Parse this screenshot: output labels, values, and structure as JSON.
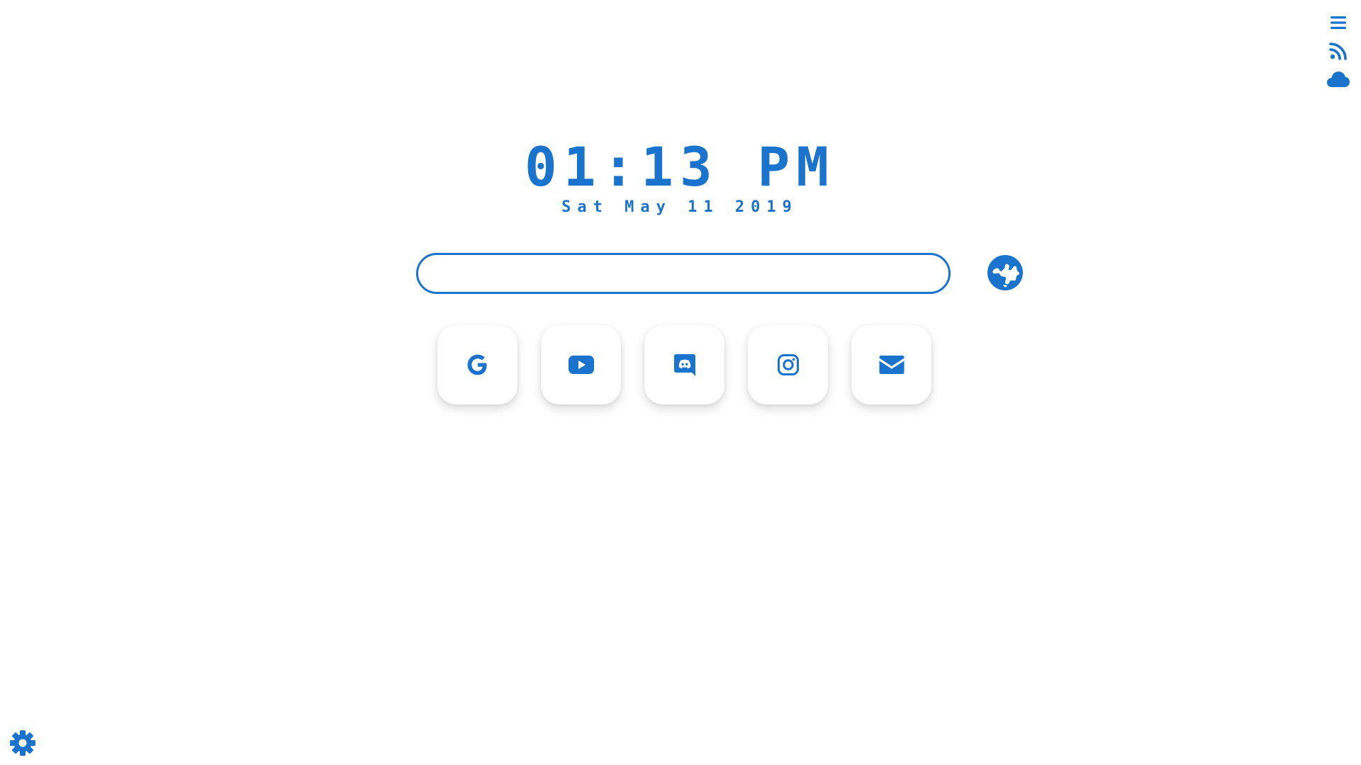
{
  "theme": {
    "accent": "#1a73cc",
    "background": "#ffffff"
  },
  "side_menu": {
    "items": [
      {
        "icon": "menu-icon"
      },
      {
        "icon": "rss-feed-icon"
      },
      {
        "icon": "cloud-icon"
      }
    ]
  },
  "clock": {
    "time": "01:13 PM",
    "date": "Sat May 11 2019"
  },
  "search": {
    "value": "",
    "placeholder": "",
    "engine_icon": "globe-icon"
  },
  "quick_links": [
    {
      "icon": "google-icon"
    },
    {
      "icon": "youtube-icon"
    },
    {
      "icon": "discord-icon"
    },
    {
      "icon": "instagram-icon"
    },
    {
      "icon": "mail-icon"
    }
  ],
  "settings": {
    "icon": "gear-icon"
  }
}
